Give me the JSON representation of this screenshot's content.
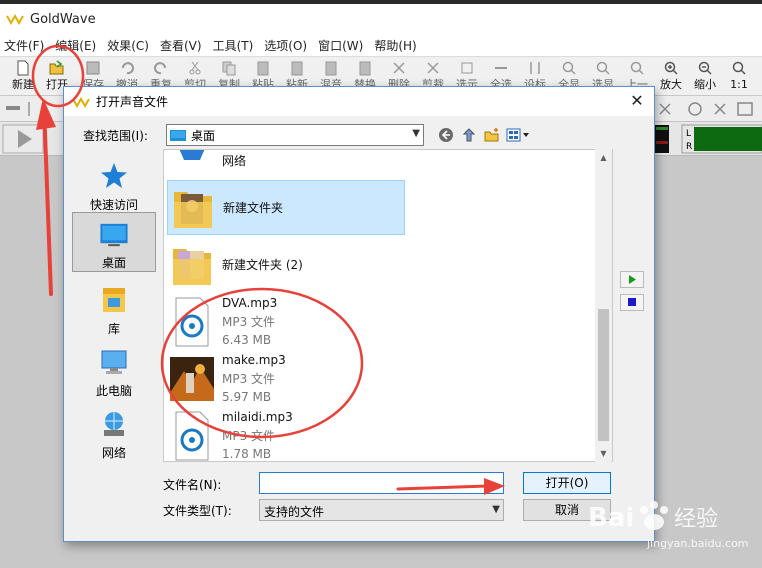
{
  "app": {
    "title": "GoldWave"
  },
  "menu": [
    "文件(F)",
    "编辑(E)",
    "效果(C)",
    "查看(V)",
    "工具(T)",
    "选项(O)",
    "窗口(W)",
    "帮助(H)"
  ],
  "toolbar": {
    "buttons": [
      "新建",
      "打开",
      "保存",
      "撤消",
      "重复",
      "剪切",
      "复制",
      "粘贴",
      "粘新",
      "混音",
      "替换",
      "删除",
      "剪裁",
      "选示",
      "全选",
      "设标",
      "全显",
      "选显",
      "上一",
      "放大",
      "缩小",
      "1:1"
    ]
  },
  "dialog": {
    "title": "打开声音文件",
    "close": "✕",
    "look_in_label": "查找范围(I):",
    "look_in_value": "桌面",
    "places": [
      {
        "label": "快速访问",
        "icon": "star-icon"
      },
      {
        "label": "桌面",
        "icon": "desktop-icon"
      },
      {
        "label": "库",
        "icon": "library-icon"
      },
      {
        "label": "此电脑",
        "icon": "computer-icon"
      },
      {
        "label": "网络",
        "icon": "network-icon"
      }
    ],
    "partial_item": "网络",
    "files": [
      {
        "name": "新建文件夹",
        "type": "",
        "size": "",
        "icon": "folder-photo-icon"
      },
      {
        "name": "新建文件夹 (2)",
        "type": "",
        "size": "",
        "icon": "folder-photo-icon"
      },
      {
        "name": "DVA.mp3",
        "type": "MP3 文件",
        "size": "6.43 MB",
        "icon": "audio-file-icon"
      },
      {
        "name": "make.mp3",
        "type": "MP3 文件",
        "size": "5.97 MB",
        "icon": "album-art-thumbnail"
      },
      {
        "name": "milaidi.mp3",
        "type": "MP3 文件",
        "size": "1.78 MB",
        "icon": "audio-file-icon"
      }
    ],
    "filename_label": "文件名(N):",
    "filename_value": "",
    "filetype_label": "文件类型(T):",
    "filetype_value": "支持的文件",
    "open_button": "打开(O)",
    "cancel_button": "取消"
  },
  "watermark": {
    "url": "jingyan.baidu.com",
    "brand_text": "经验"
  },
  "colors": {
    "annotation": "#e8413a",
    "selection": "#cce8ff",
    "accent": "#0078d7"
  }
}
